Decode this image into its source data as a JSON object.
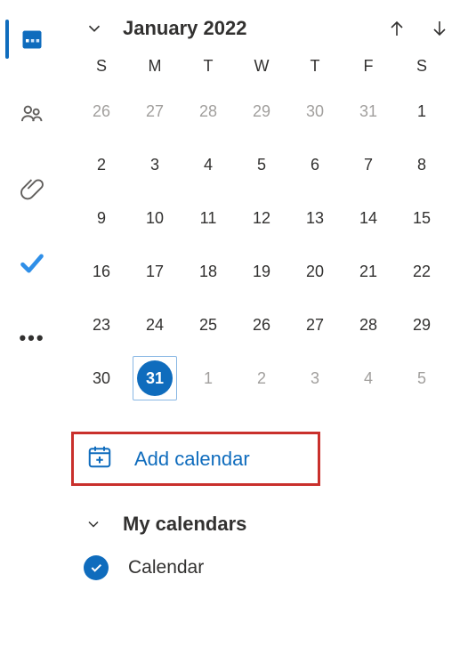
{
  "rail": {
    "items": [
      "calendar",
      "people",
      "attachments",
      "todo",
      "more"
    ]
  },
  "calendar": {
    "month_label": "January 2022",
    "dow": [
      "S",
      "M",
      "T",
      "W",
      "T",
      "F",
      "S"
    ],
    "weeks": [
      [
        {
          "d": "26",
          "m": false
        },
        {
          "d": "27",
          "m": false
        },
        {
          "d": "28",
          "m": false
        },
        {
          "d": "29",
          "m": false
        },
        {
          "d": "30",
          "m": false
        },
        {
          "d": "31",
          "m": false
        },
        {
          "d": "1",
          "m": true
        }
      ],
      [
        {
          "d": "2",
          "m": true
        },
        {
          "d": "3",
          "m": true
        },
        {
          "d": "4",
          "m": true
        },
        {
          "d": "5",
          "m": true
        },
        {
          "d": "6",
          "m": true
        },
        {
          "d": "7",
          "m": true
        },
        {
          "d": "8",
          "m": true
        }
      ],
      [
        {
          "d": "9",
          "m": true
        },
        {
          "d": "10",
          "m": true
        },
        {
          "d": "11",
          "m": true
        },
        {
          "d": "12",
          "m": true
        },
        {
          "d": "13",
          "m": true
        },
        {
          "d": "14",
          "m": true
        },
        {
          "d": "15",
          "m": true
        }
      ],
      [
        {
          "d": "16",
          "m": true
        },
        {
          "d": "17",
          "m": true
        },
        {
          "d": "18",
          "m": true
        },
        {
          "d": "19",
          "m": true
        },
        {
          "d": "20",
          "m": true
        },
        {
          "d": "21",
          "m": true
        },
        {
          "d": "22",
          "m": true
        }
      ],
      [
        {
          "d": "23",
          "m": true
        },
        {
          "d": "24",
          "m": true
        },
        {
          "d": "25",
          "m": true
        },
        {
          "d": "26",
          "m": true
        },
        {
          "d": "27",
          "m": true
        },
        {
          "d": "28",
          "m": true
        },
        {
          "d": "29",
          "m": true
        }
      ],
      [
        {
          "d": "30",
          "m": true
        },
        {
          "d": "31",
          "m": true,
          "today": true
        },
        {
          "d": "1",
          "m": false
        },
        {
          "d": "2",
          "m": false
        },
        {
          "d": "3",
          "m": false
        },
        {
          "d": "4",
          "m": false
        },
        {
          "d": "5",
          "m": false
        }
      ]
    ]
  },
  "add_calendar_label": "Add calendar",
  "sections": {
    "my_calendars_label": "My calendars",
    "items": [
      {
        "label": "Calendar",
        "checked": true
      }
    ]
  },
  "colors": {
    "accent": "#0f6cbd",
    "highlight_border": "#c9302c"
  }
}
